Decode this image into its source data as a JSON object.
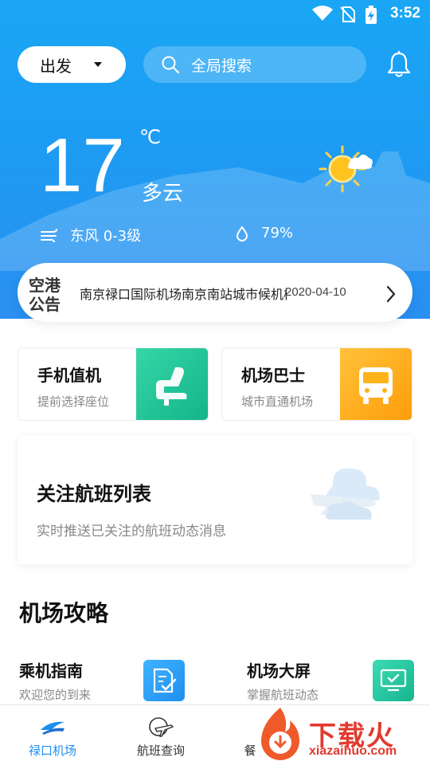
{
  "status_bar": {
    "time": "3:52"
  },
  "header": {
    "departure_label": "出发",
    "search_placeholder": "全局搜索"
  },
  "weather": {
    "temperature": "17",
    "unit": "℃",
    "condition": "多云",
    "wind": "东风 0-3级",
    "humidity": "79%"
  },
  "notice": {
    "tag": "空港公告",
    "text": "南京禄口国际机场南京南站城市候机楼",
    "date": "2020-04-10"
  },
  "cards": [
    {
      "title": "手机值机",
      "subtitle": "提前选择座位",
      "color": "#1fc59a"
    },
    {
      "title": "机场巴士",
      "subtitle": "城市直通机场",
      "color": "#ffb21a"
    }
  ],
  "follow": {
    "title": "关注航班列表",
    "subtitle": "实时推送已关注的航班动态消息"
  },
  "section": {
    "title": "机场攻略"
  },
  "guides": [
    {
      "title": "乘机指南",
      "subtitle": "欢迎您的到来",
      "icon": "document-check-icon",
      "color": "#2a9ff2"
    },
    {
      "title": "机场大屏",
      "subtitle": "掌握航班动态",
      "icon": "monitor-check-icon",
      "color": "#22c4a0"
    }
  ],
  "bottom_nav": [
    {
      "label": "禄口机场",
      "active": true
    },
    {
      "label": "航班查询",
      "active": false
    },
    {
      "label": "餐",
      "active": false
    }
  ],
  "watermark": {
    "text": "下载火",
    "sub": "xiazaihuo.com"
  }
}
